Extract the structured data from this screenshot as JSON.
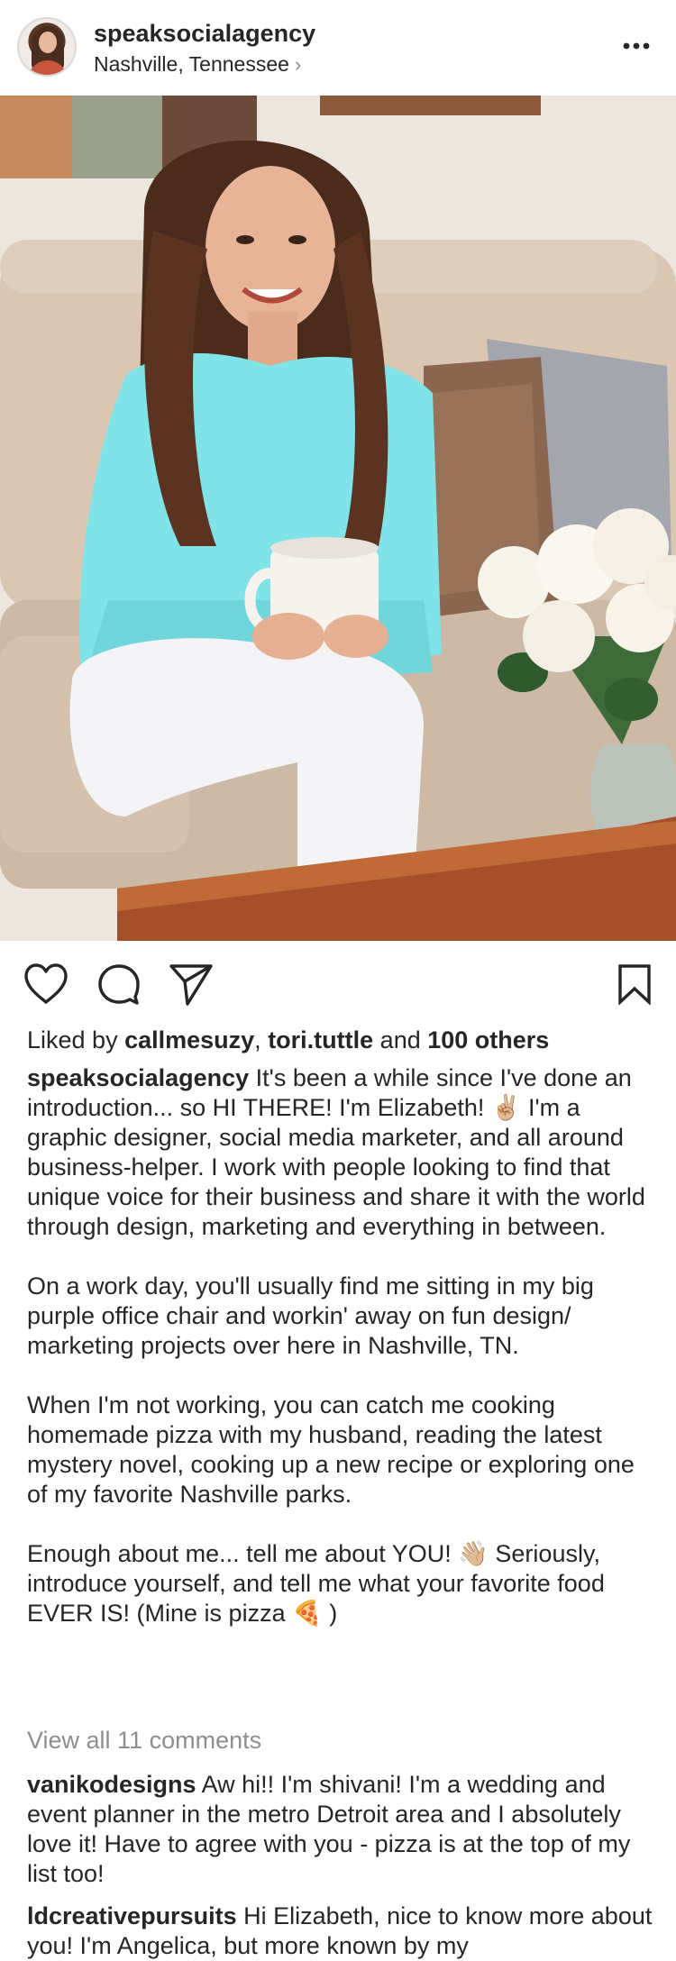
{
  "post": {
    "username": "speaksocialagency",
    "location": "Nashville, Tennessee",
    "location_chevron": "›",
    "more_icon": "more-horizontal-icon"
  },
  "likes": {
    "prefix": "Liked by ",
    "user1": "callmesuzy",
    "sep": ", ",
    "user2": "tori.tuttle",
    "and": " and ",
    "others": "100 others"
  },
  "caption": {
    "username": "speaksocialagency",
    "p1": "It's been a while since I've done an introduction... so HI THERE! I'm Elizabeth! ✌🏼 I'm a graphic designer, social media marketer, and all around business-helper. I work with people looking to find that unique voice for their business and share it with the world through design, marketing and everything in between.",
    "p2": "On a work day, you'll usually find me sitting in my big purple office chair and workin' away on fun design/ marketing projects over here in Nashville, TN.",
    "p3": "When I'm not working, you can catch me cooking homemade pizza with my husband, reading the latest mystery novel, cooking up a new recipe or exploring one of my favorite Nashville parks.",
    "p4": "Enough about me... tell me about YOU! 👋🏼 Seriously, introduce yourself, and tell me what your favorite food EVER IS! (Mine is pizza 🍕 )"
  },
  "view_all_comments": "View all 11 comments",
  "comments": [
    {
      "username": "vanikodesigns",
      "text": "Aw hi!! I'm shivani! I'm a wedding and event planner in the metro Detroit area and I absolutely love it! Have to agree with you - pizza is at the top of my list too!"
    },
    {
      "username": "ldcreativepursuits",
      "text": "Hi Elizabeth, nice to know more about you! I'm Angelica, but more known by my"
    }
  ],
  "colors": {
    "text": "#262626",
    "muted": "#8e8e8e",
    "shirt": "#7fe3e8",
    "sofa": "#d8c8b6",
    "table": "#a4512a"
  }
}
